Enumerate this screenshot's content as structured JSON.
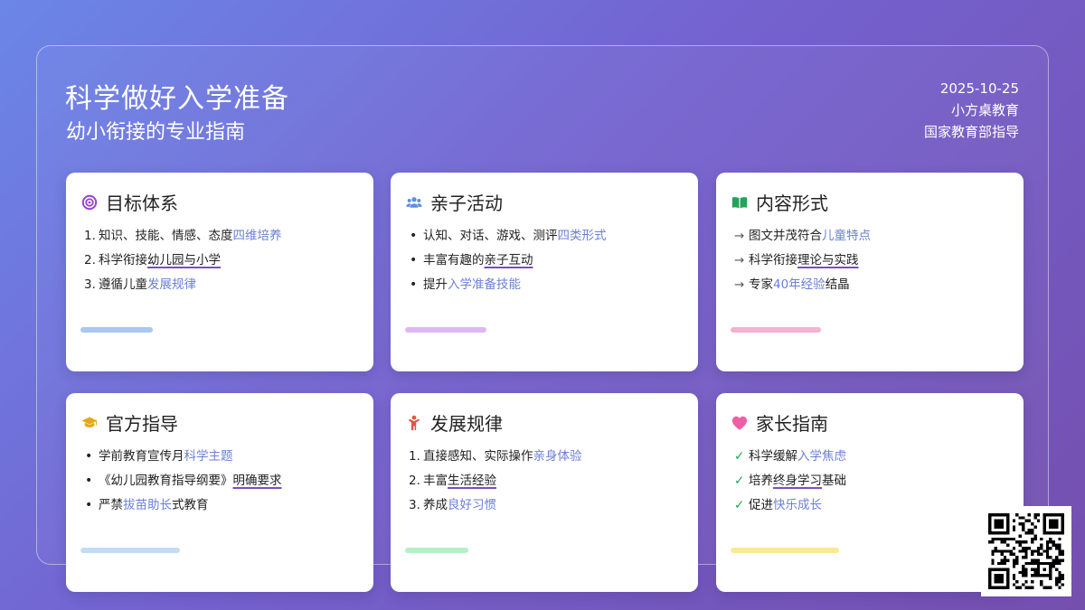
{
  "header": {
    "title": "科学做好入学准备",
    "subtitle": "幼小衔接的专业指南",
    "date": "2025-10-25",
    "brand": "小方桌教育",
    "guidance": "国家教育部指导"
  },
  "colors": {
    "highlight": "#6b7fd6",
    "underline": "#7b4cc4",
    "bars": [
      "#a8c8f0",
      "#dcb8f3",
      "#f5b1d2",
      "#c3dcf5",
      "#b8efc8",
      "#fbe991"
    ]
  },
  "cards": [
    {
      "title": "目标体系",
      "icon": "target-icon",
      "marker": "number",
      "items": [
        {
          "marker": "1.",
          "text": "知识、技能、情感、态度",
          "accent": "四维培养",
          "accent_style": "highlight",
          "tail": ""
        },
        {
          "marker": "2.",
          "text": "科学衔接",
          "accent": "幼儿园与小学",
          "accent_style": "underline",
          "tail": ""
        },
        {
          "marker": "3.",
          "text": "遵循儿童",
          "accent": "发展规律",
          "accent_style": "highlight",
          "tail": ""
        }
      ]
    },
    {
      "title": "亲子活动",
      "icon": "users-icon",
      "marker": "bullet",
      "items": [
        {
          "marker": "•",
          "text": "认知、对话、游戏、测评",
          "accent": "四类形式",
          "accent_style": "highlight",
          "tail": ""
        },
        {
          "marker": "•",
          "text": "丰富有趣的",
          "accent": "亲子互动",
          "accent_style": "underline",
          "tail": ""
        },
        {
          "marker": "•",
          "text": "提升",
          "accent": "入学准备技能",
          "accent_style": "highlight",
          "tail": ""
        }
      ]
    },
    {
      "title": "内容形式",
      "icon": "book-open-icon",
      "marker": "arrow",
      "items": [
        {
          "marker": "→",
          "text": "图文并茂符合",
          "accent": "儿童特点",
          "accent_style": "highlight",
          "tail": ""
        },
        {
          "marker": "→",
          "text": "科学衔接",
          "accent": "理论与实践",
          "accent_style": "underline",
          "tail": ""
        },
        {
          "marker": "→",
          "text": "专家",
          "accent": "40年经验",
          "accent_style": "highlight",
          "tail": "结晶"
        }
      ]
    },
    {
      "title": "官方指导",
      "icon": "graduation-cap-icon",
      "marker": "bullet",
      "items": [
        {
          "marker": "•",
          "text": "学前教育宣传月",
          "accent": "科学主题",
          "accent_style": "highlight",
          "tail": ""
        },
        {
          "marker": "•",
          "text": "《幼儿园教育指导纲要》",
          "accent": "明确要求",
          "accent_style": "underline",
          "tail": ""
        },
        {
          "marker": "•",
          "text": "严禁",
          "accent": "拔苗助长",
          "accent_style": "highlight",
          "tail": "式教育"
        }
      ]
    },
    {
      "title": "发展规律",
      "icon": "child-icon",
      "marker": "number",
      "items": [
        {
          "marker": "1.",
          "text": "直接感知、实际操作",
          "accent": "亲身体验",
          "accent_style": "highlight",
          "tail": ""
        },
        {
          "marker": "2.",
          "text": "丰富",
          "accent": "生活经验",
          "accent_style": "underline",
          "tail": ""
        },
        {
          "marker": "3.",
          "text": "养成",
          "accent": "良好习惯",
          "accent_style": "highlight",
          "tail": ""
        }
      ]
    },
    {
      "title": "家长指南",
      "icon": "heart-icon",
      "marker": "check",
      "items": [
        {
          "marker": "✓",
          "text": "科学缓解",
          "accent": "入学焦虑",
          "accent_style": "highlight",
          "tail": ""
        },
        {
          "marker": "✓",
          "text": "培养",
          "accent": "终身学习",
          "accent_style": "underline",
          "tail": "基础"
        },
        {
          "marker": "✓",
          "text": "促进",
          "accent": "快乐成长",
          "accent_style": "highlight",
          "tail": ""
        }
      ]
    }
  ]
}
